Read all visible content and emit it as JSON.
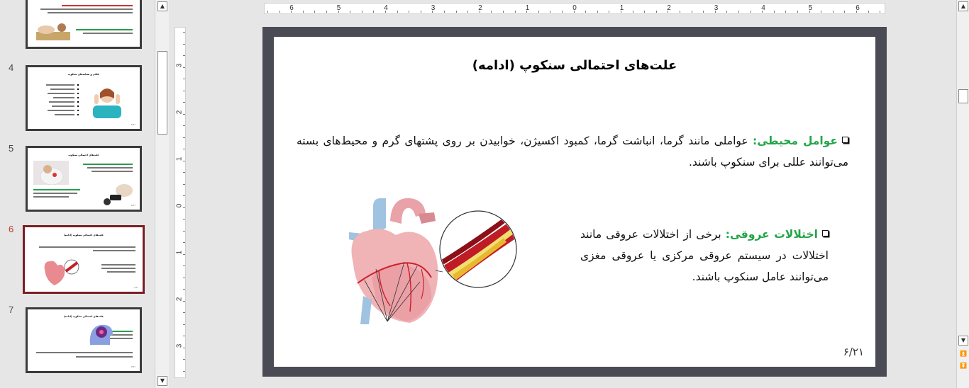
{
  "thumbnails": [
    {
      "number": "",
      "title": ""
    },
    {
      "number": "4",
      "title": "علائم و نشانه‌های سنکوپ"
    },
    {
      "number": "5",
      "title": "علت‌های احتمالی سنکوپ"
    },
    {
      "number": "6",
      "title": "علت‌های احتمالی سنکوپ (ادامه)"
    },
    {
      "number": "7",
      "title": "علت‌های احتمالی سنکوپ (ادامه)"
    }
  ],
  "ruler": {
    "horizontal": [
      "6",
      "5",
      "4",
      "3",
      "2",
      "1",
      "0",
      "1",
      "2",
      "3",
      "4",
      "5",
      "6"
    ],
    "vertical": [
      "3",
      "2",
      "1",
      "0",
      "1",
      "2",
      "3"
    ]
  },
  "slide": {
    "title": "علت‌های احتمالی سنکوپ (ادامه)",
    "bullet1_label": "عوامل محیطی:",
    "bullet1_text": " عواملی مانند گرما، انباشت گرما، کمبود اکسیژن، خوابیدن بر روی پشتهای گرم و محیط‌های بسته می‌توانند عللی برای سنکوپ باشند.",
    "bullet2_label": "اختلالات عروقی:",
    "bullet2_text": " برخی از اختلالات عروقی مانند اختلالات در سیستم عروقی مرکزی یا عروقی مغزی می‌توانند عامل سنکوپ باشند.",
    "page_number": "۶/۲۱",
    "image_label": "heart-artery-illustration"
  },
  "colors": {
    "highlight": "#22a547",
    "active_thumb_border": "#7a1f24",
    "slide_frame": "#4b4b55"
  }
}
